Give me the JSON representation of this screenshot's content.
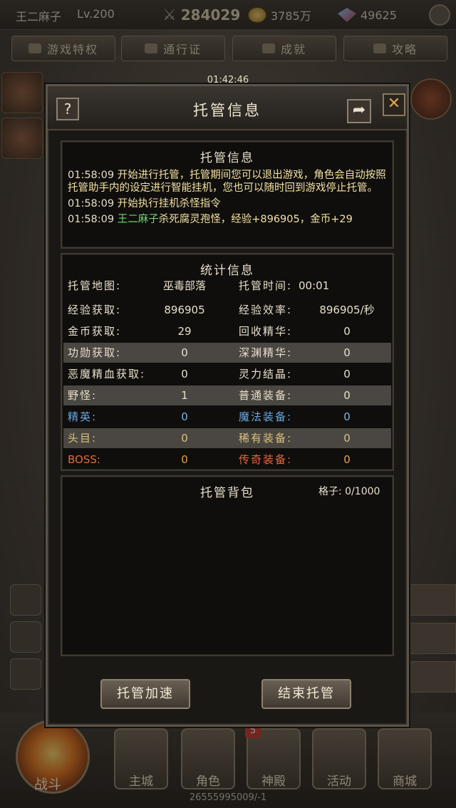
{
  "topbar": {
    "player_name": "王二麻子",
    "level": "Lv.200",
    "power": "284029",
    "gold": "3785万",
    "gems": "49625"
  },
  "nav_tabs": [
    "游戏特权",
    "通行证",
    "成就",
    "攻略"
  ],
  "timer": "01:42:46",
  "modal": {
    "title": "托管信息",
    "help_label": "?",
    "close_label": "✕",
    "log": {
      "title": "托管信息",
      "lines": [
        {
          "time": "01:58:09",
          "text": "开始进行托管，托管期间您可以退出游戏，角色会自动按照托管助手内的设定进行智能挂机，您也可以随时回到游戏停止托管。"
        },
        {
          "time": "01:58:09",
          "text": "开始执行挂机杀怪指令"
        },
        {
          "time": "01:58:09",
          "name": "王二麻子",
          "text": "杀死腐灵孢怪，经验+896905，金币+29"
        }
      ]
    },
    "stats": {
      "title": "统计信息",
      "rows": [
        {
          "k1": "托管地图:",
          "v1": "巫毒部落",
          "k2": "托管时间:",
          "v2": "00:01"
        },
        {
          "k1": "经验获取:",
          "v1": "896905",
          "k2": "经验效率:",
          "v2": "896905/秒"
        },
        {
          "k1": "金币获取:",
          "v1": "29",
          "k2": "回收精华:",
          "v2": "0"
        },
        {
          "k1": "功勋获取:",
          "v1": "0",
          "k2": "深渊精华:",
          "v2": "0"
        },
        {
          "k1": "恶魔精血获取:",
          "v1": "0",
          "k2": "灵力结晶:",
          "v2": "0"
        },
        {
          "k1": "野怪:",
          "v1": "1",
          "k2": "普通装备:",
          "v2": "0"
        },
        {
          "k1": "精英:",
          "v1": "0",
          "k2": "魔法装备:",
          "v2": "0"
        },
        {
          "k1": "头目:",
          "v1": "0",
          "k2": "稀有装备:",
          "v2": "0"
        },
        {
          "k1": "BOSS:",
          "v1": "0",
          "k2": "传奇装备:",
          "v2": "0"
        }
      ]
    },
    "bag": {
      "title": "托管背包",
      "capacity": "格子: 0/1000"
    },
    "buttons": {
      "speed_up": "托管加速",
      "end": "结束托管"
    }
  },
  "bottom_nav": {
    "fight": "战斗",
    "items": [
      "主城",
      "角色",
      "神殿",
      "活动",
      "商城"
    ],
    "temple_badge": "5",
    "server_info": "26555995009/-1"
  }
}
